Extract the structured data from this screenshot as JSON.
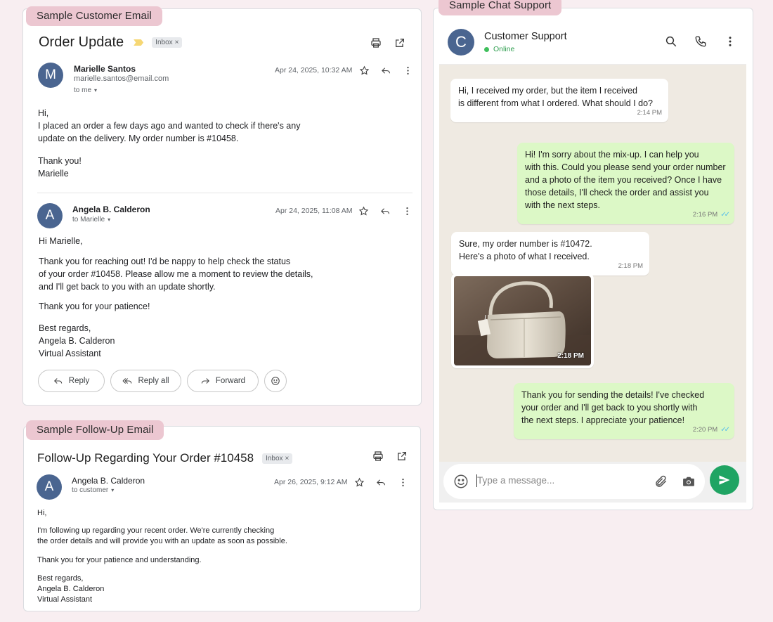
{
  "labels": {
    "customer_email": "Sample Customer Email",
    "chat_support": "Sample Chat Support",
    "followup_email": "Sample Follow-Up Email"
  },
  "email1": {
    "subject": "Order Update",
    "inbox_chip": "Inbox",
    "messages": [
      {
        "avatar": "M",
        "sender": "Marielle Santos",
        "email": "marielle.santos@email.com",
        "to": "to me",
        "date": "Apr 24, 2025, 10:32 AM",
        "body": [
          "Hi,",
          "I placed an order a few days ago and wanted to check if there's any",
          "update on the delivery. My order number is #10458.",
          "Thank you!",
          "Marielle"
        ]
      },
      {
        "avatar": "A",
        "sender": "Angela B. Calderon",
        "to": "to Marielle",
        "date": "Apr 24, 2025, 11:08 AM",
        "body": [
          "Hi Marielle,",
          "Thank you for reaching out!  I'd be nappy to help check the status",
          "of your order #10458. Please allow me a moment to review the details,",
          "and I'll get back to you with an update shortly.",
          "Thank you for your patience!",
          "Best regards,",
          "Angela B. Calderon",
          "Virtual Assistant"
        ]
      }
    ],
    "actions": {
      "reply": "Reply",
      "reply_all": "Reply all",
      "forward": "Forward"
    }
  },
  "email2": {
    "subject": "Follow-Up Regarding Your Order #10458",
    "inbox_chip": "Inbox",
    "avatar": "A",
    "sender": "Angela B. Calderon",
    "to": "to customer",
    "date": "Apr 26, 2025, 9:12 AM",
    "body": [
      "Hi,",
      "I'm following up regarding your recent order. We're currently checking",
      "the order details and will provide you with an update as soon as possible.",
      "Thank you for your patience and understanding.",
      "Best regards,",
      "Angela B. Calderon",
      "Virtual Assistant"
    ]
  },
  "chat": {
    "avatar": "C",
    "name": "Customer Support",
    "status": "Online",
    "messages": [
      {
        "dir": "in",
        "lines": [
          "Hi, I received my order, but the item I received",
          "is different from what I ordered. What should I do?"
        ],
        "time": "2:14 PM"
      },
      {
        "dir": "out",
        "lines": [
          "Hi! I'm sorry about the mix-up. I can help you",
          "with this. Could you please send your order number",
          "and a photo of the item you received? Once I have",
          "those details, I'll check the order and assist you",
          "with the next steps."
        ],
        "time": "2:16 PM"
      },
      {
        "dir": "in",
        "lines": [
          "Sure, my order number is #10472.",
          "Here's a photo of what I received."
        ],
        "time": "2:18 PM"
      },
      {
        "dir": "in-image",
        "time": "2:18 PM"
      },
      {
        "dir": "out",
        "lines": [
          "Thank you for sending the details! I've checked",
          "your order and I'll get back to you shortly with",
          "the next steps. I appreciate your patience!"
        ],
        "time": "2:20 PM"
      }
    ],
    "composer_placeholder": "Type a message..."
  }
}
